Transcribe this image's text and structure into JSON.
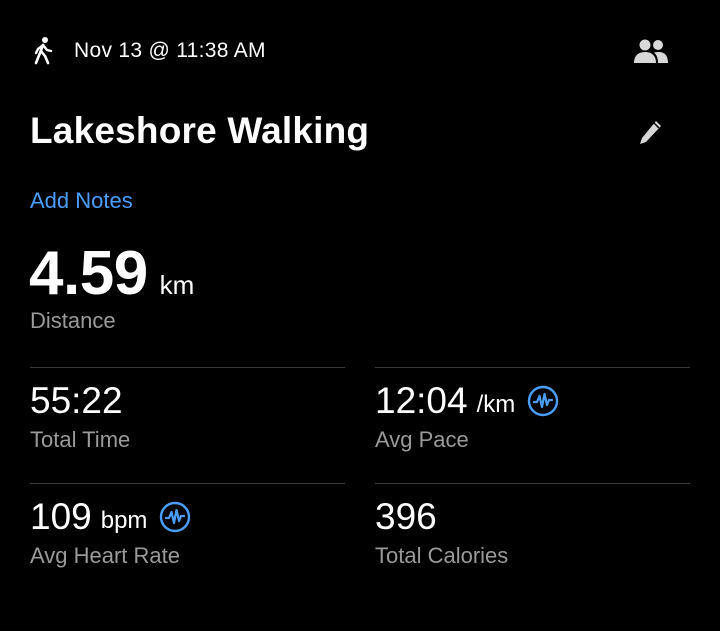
{
  "header": {
    "activity_icon": "walking-person-icon",
    "datetime": "Nov 13 @ 11:38 AM",
    "share_icon": "people-icon"
  },
  "activity": {
    "title": "Lakeshore Walking",
    "edit_icon": "pencil-icon",
    "add_notes_label": "Add Notes"
  },
  "distance": {
    "value": "4.59",
    "unit": "km",
    "label": "Distance"
  },
  "stats": [
    {
      "value": "55:22",
      "unit": "",
      "label": "Total Time",
      "has_graph": false
    },
    {
      "value": "12:04",
      "unit": "/km",
      "label": "Avg Pace",
      "has_graph": true
    },
    {
      "value": "109",
      "unit": "bpm",
      "label": "Avg Heart Rate",
      "has_graph": true
    },
    {
      "value": "396",
      "unit": "",
      "label": "Total Calories",
      "has_graph": false
    }
  ],
  "colors": {
    "background": "#000000",
    "accent": "#4a9eff",
    "label_gray": "#9a9a9a",
    "divider": "#3a3a3a"
  }
}
